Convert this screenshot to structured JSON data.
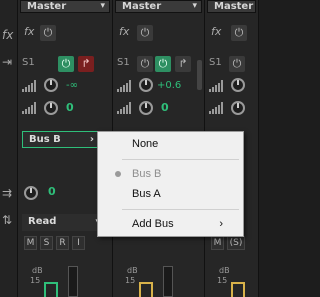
{
  "channel": {
    "master_label": "Master",
    "input_label": "S1",
    "send_level_1": "-∞",
    "send_level_2": "+0.6",
    "pan_value": "0",
    "pan_value_2": "0",
    "bus_selected": "Bus B",
    "automation_mode": "Read",
    "msri": [
      "M",
      "S",
      "R",
      "I"
    ],
    "msri_alt": [
      "M",
      "(S)"
    ],
    "db_label": "dB",
    "db_tick": "15"
  },
  "menu": {
    "items": [
      {
        "label": "None",
        "disabled": false
      },
      {
        "label": "Bus B",
        "disabled": true,
        "checked": true
      },
      {
        "label": "Bus A",
        "disabled": false
      },
      {
        "label": "Add Bus",
        "disabled": false,
        "submenu": true
      }
    ]
  },
  "icons": {
    "fx": "fx",
    "power": "⏻",
    "chevron_down": "▾",
    "chevron_right": "›",
    "submenu_arrow": "›"
  }
}
